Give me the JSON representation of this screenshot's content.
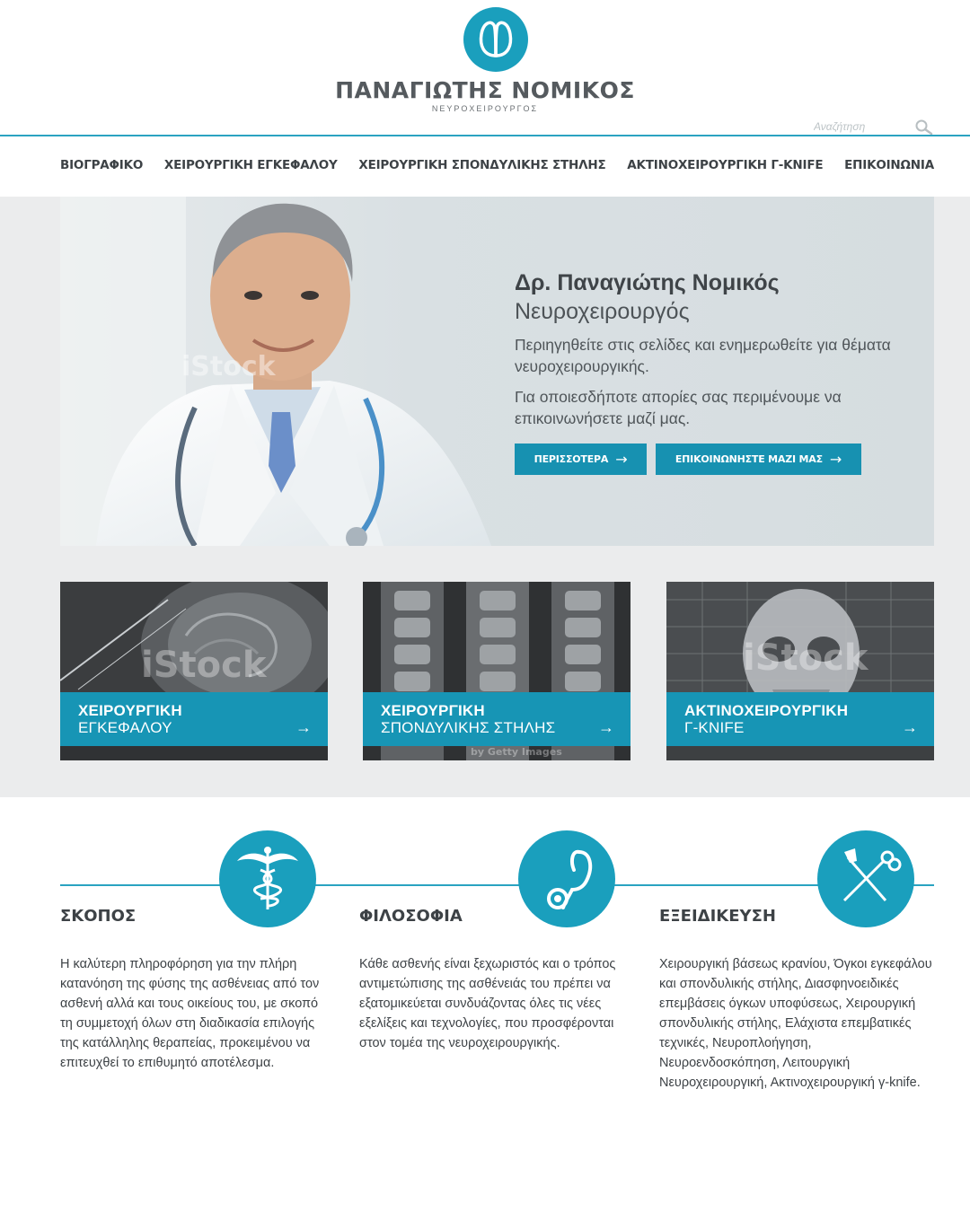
{
  "header": {
    "brand_name": "ΠΑΝΑΓΙΩΤΗΣ ΝΟΜΙΚΟΣ",
    "brand_subtitle": "ΝΕΥΡΟΧΕΙΡΟΥΡΓΟΣ",
    "search_placeholder": "Αναζήτηση",
    "logo_icon": "brain-logo-icon",
    "search_icon": "search-icon"
  },
  "nav": {
    "items": [
      {
        "label": "ΒΙΟΓΡΑΦΙΚΟ"
      },
      {
        "label": "ΧΕΙΡΟΥΡΓΙΚΗ ΕΓΚΕΦΑΛΟΥ"
      },
      {
        "label": "ΧΕΙΡΟΥΡΓΙΚΗ ΣΠΟΝΔΥΛΙΚΗΣ ΣΤΗΛΗΣ"
      },
      {
        "label": "ΑΚΤΙΝΟΧΕΙΡΟΥΡΓΙΚΗ Γ-KNIFE"
      },
      {
        "label": "ΕΠΙΚΟΙΝΩΝΙΑ"
      }
    ]
  },
  "hero": {
    "title": "Δρ. Παναγιώτης Νομικός",
    "subtitle": "Νευροχειρουργός",
    "text1": "Περιηγηθείτε στις σελίδες και ενημερωθείτε για θέματα νευροχειρουργικής.",
    "text2": "Για οποιεσδήποτε απορίες σας περιμένουμε να επικοινωνήσετε μαζί μας.",
    "btn_more": "ΠΕΡΙΣΣΟΤΕΡΑ",
    "btn_contact": "ΕΠΙΚΟΙΝΩΝΗΣΤΕ ΜΑΖΙ ΜΑΣ",
    "arrow": "→",
    "photo_watermark": "iStock"
  },
  "cards": [
    {
      "line1": "ΧΕΙΡΟΥΡΓΙΚΗ",
      "line2": "ΕΓΚΕΦΑΛΟΥ",
      "arrow": "→",
      "watermark": "iStock"
    },
    {
      "line1": "ΧΕΙΡΟΥΡΓΙΚΗ",
      "line2": "ΣΠΟΝΔΥΛΙΚΗΣ ΣΤΗΛΗΣ",
      "arrow": "→",
      "watermark": "by Getty Images"
    },
    {
      "line1": "ΑΚΤΙΝΟΧΕΙΡΟΥΡΓΙΚΗ",
      "line2": "Γ-KNIFE",
      "arrow": "→",
      "watermark": "iStock"
    }
  ],
  "sections": [
    {
      "heading": "ΣΚΟΠΟΣ",
      "icon": "caduceus-icon",
      "text": "Η καλύτερη πληροφόρηση για την πλήρη κατανόηση της φύσης της ασθένειας από τον ασθενή αλλά και τους οικείους του, με σκοπό τη συμμετοχή όλων στη διαδικασία επιλογής της κατάλληλης θεραπείας, προκειμένου να επιτευχθεί το επιθυμητό αποτέλεσμα."
    },
    {
      "heading": "ΦΙΛΟΣΟΦΙΑ",
      "icon": "stethoscope-icon",
      "text": "Κάθε ασθενής είναι ξεχωριστός και ο τρόπος αντιμετώπισης της ασθένειάς του πρέπει να εξατομικεύεται συνδυάζοντας όλες τις νέες εξελίξεις και τεχνολογίες, που προσφέρονται στον τομέα της νευροχειρουργικής."
    },
    {
      "heading": "ΕΞΕΙΔΙΚΕΥΣΗ",
      "icon": "surgical-tools-icon",
      "text": "Χειρουργική βάσεως κρανίου, Όγκοι εγκεφάλου και σπονδυλικής στήλης, Διασφηνοειδικές επεμβάσεις όγκων υποφύσεως, Χειρουργική σπονδυλικής στήλης, Ελάχιστα επεμβατικές τεχνικές, Νευροπλοήγηση, Νευροενδοσκόπηση, Λειτουργική Νευροχειρουργική, Ακτινοχειρουργική γ-knife."
    }
  ],
  "colors": {
    "accent": "#1a9fbd",
    "button": "#1791b1",
    "text": "#3d4246"
  }
}
